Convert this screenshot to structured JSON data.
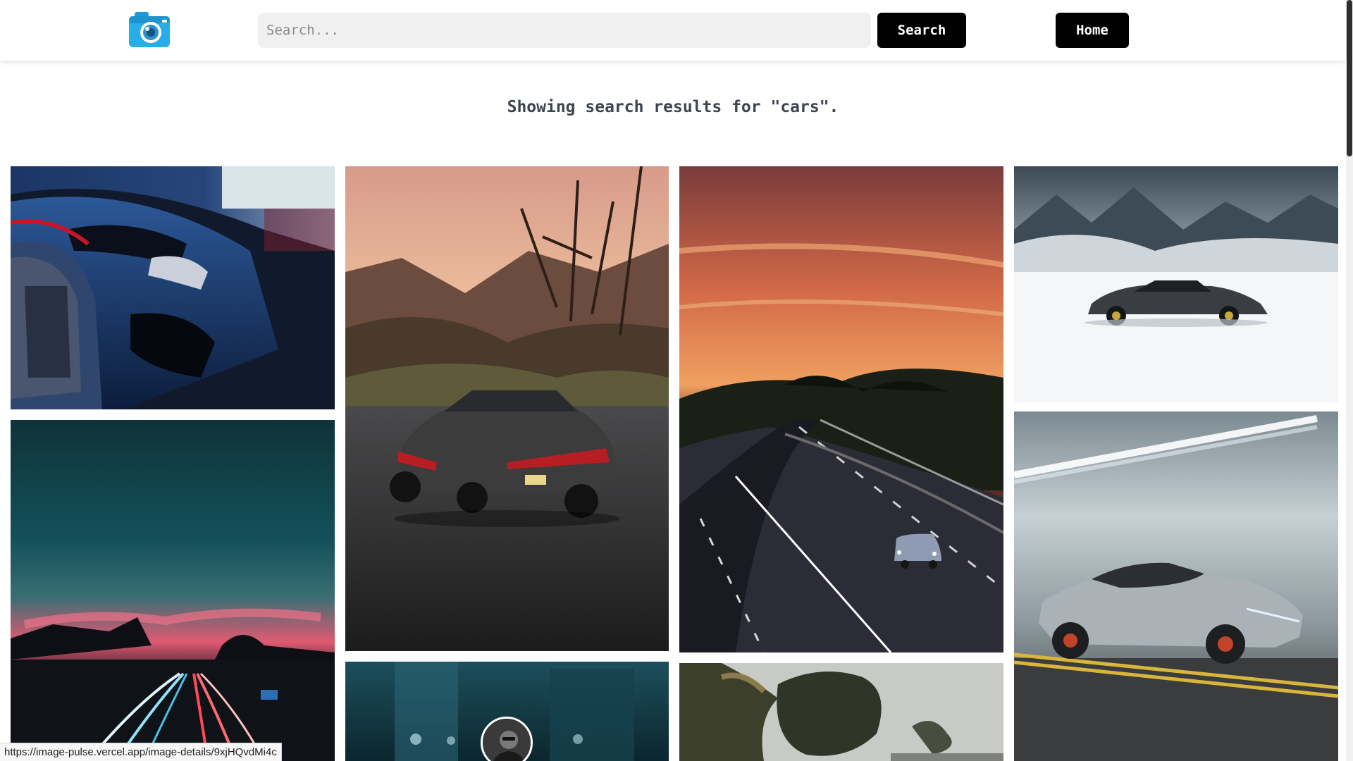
{
  "navbar": {
    "logo_icon": "camera-icon",
    "search": {
      "placeholder": "Search...",
      "value": ""
    },
    "search_button_label": "Search",
    "home_button_label": "Home"
  },
  "results": {
    "heading": "Showing search results for \"cars\"."
  },
  "gallery": {
    "photos": [
      {
        "name": "photo-parked-blue-cars"
      },
      {
        "name": "photo-dark-sedan-mountains"
      },
      {
        "name": "photo-highway-sunset"
      },
      {
        "name": "photo-sports-car-snow"
      },
      {
        "name": "photo-light-trails-dusk"
      },
      {
        "name": "photo-silver-supercar-tunnel"
      },
      {
        "name": "photo-teal-street-partial"
      },
      {
        "name": "photo-trees-overcast-partial"
      }
    ]
  },
  "status_bar": {
    "url": "https://image-pulse.vercel.app/image-details/9xjHQvdMi4c"
  },
  "colors": {
    "button_bg": "#000000",
    "heading": "#3c4550",
    "search_bg": "#f0f0f0"
  }
}
